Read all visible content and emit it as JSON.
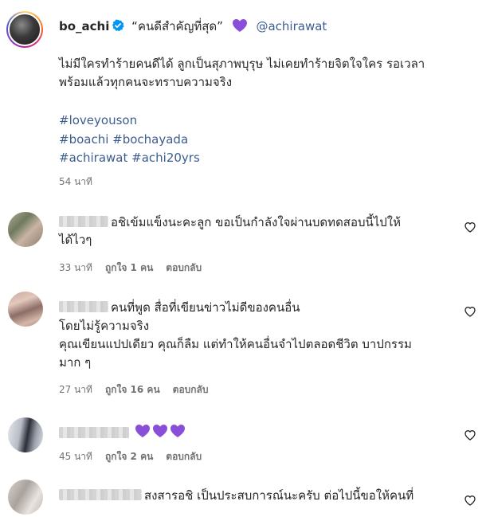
{
  "post": {
    "username": "bo_achi",
    "title": "“คนดีสำคัญที่สุด”",
    "mention": "@achirawat",
    "caption_line1": "ไม่มีใครทำร้ายคนดีได้ ลูกเป็นสุภาพบุรุษ ไม่เคยทำร้ายจิตใจใคร รอเวลา",
    "caption_line2": "พร้อมแล้วทุกคนจะทราบความจริง",
    "hashtags": [
      "#loveyouson",
      "#boachi #bochayada",
      "#achirawat #achi20yrs"
    ],
    "time": "54 นาที"
  },
  "comments": [
    {
      "text_line1": "อชิเข้มแข็งนะคะลูก ขอเป็นกำลังใจผ่านบดทดสอบนี้ไปให้",
      "text_line2": "ได้ไวๆ",
      "time": "33 นาที",
      "likes": "ถูกใจ 1 คน",
      "reply": "ตอบกลับ"
    },
    {
      "text_line1": "คนที่พูด สื่อที่เขียนข่าวไม่ดีของคนอื่น",
      "text_line2": "โดยไม่รู้ความจริง",
      "text_line3": "คุณเขียนแปปเดียว คุณก็ลืม แต่ทำให้คนอื่นจำไปตลอดชีวิต บาปกรรม",
      "text_line4": "มาก ๆ",
      "time": "27 นาที",
      "likes": "ถูกใจ 16 คน",
      "reply": "ตอบกลับ"
    },
    {
      "time": "45 นาที",
      "likes": "ถูกใจ 2 คน",
      "reply": "ตอบกลับ"
    },
    {
      "text_line1": "สงสารอชิ เป็นประสบการณ์นะครับ ต่อไปนี้ขอให้คนที่"
    }
  ],
  "colors": {
    "link": "#3b5d8f",
    "verified": "#0095f6",
    "heart_purple": "#8a4fd8",
    "muted": "#737373"
  },
  "icons": [
    "verified-badge-icon",
    "purple-heart-icon",
    "like-heart-icon"
  ]
}
